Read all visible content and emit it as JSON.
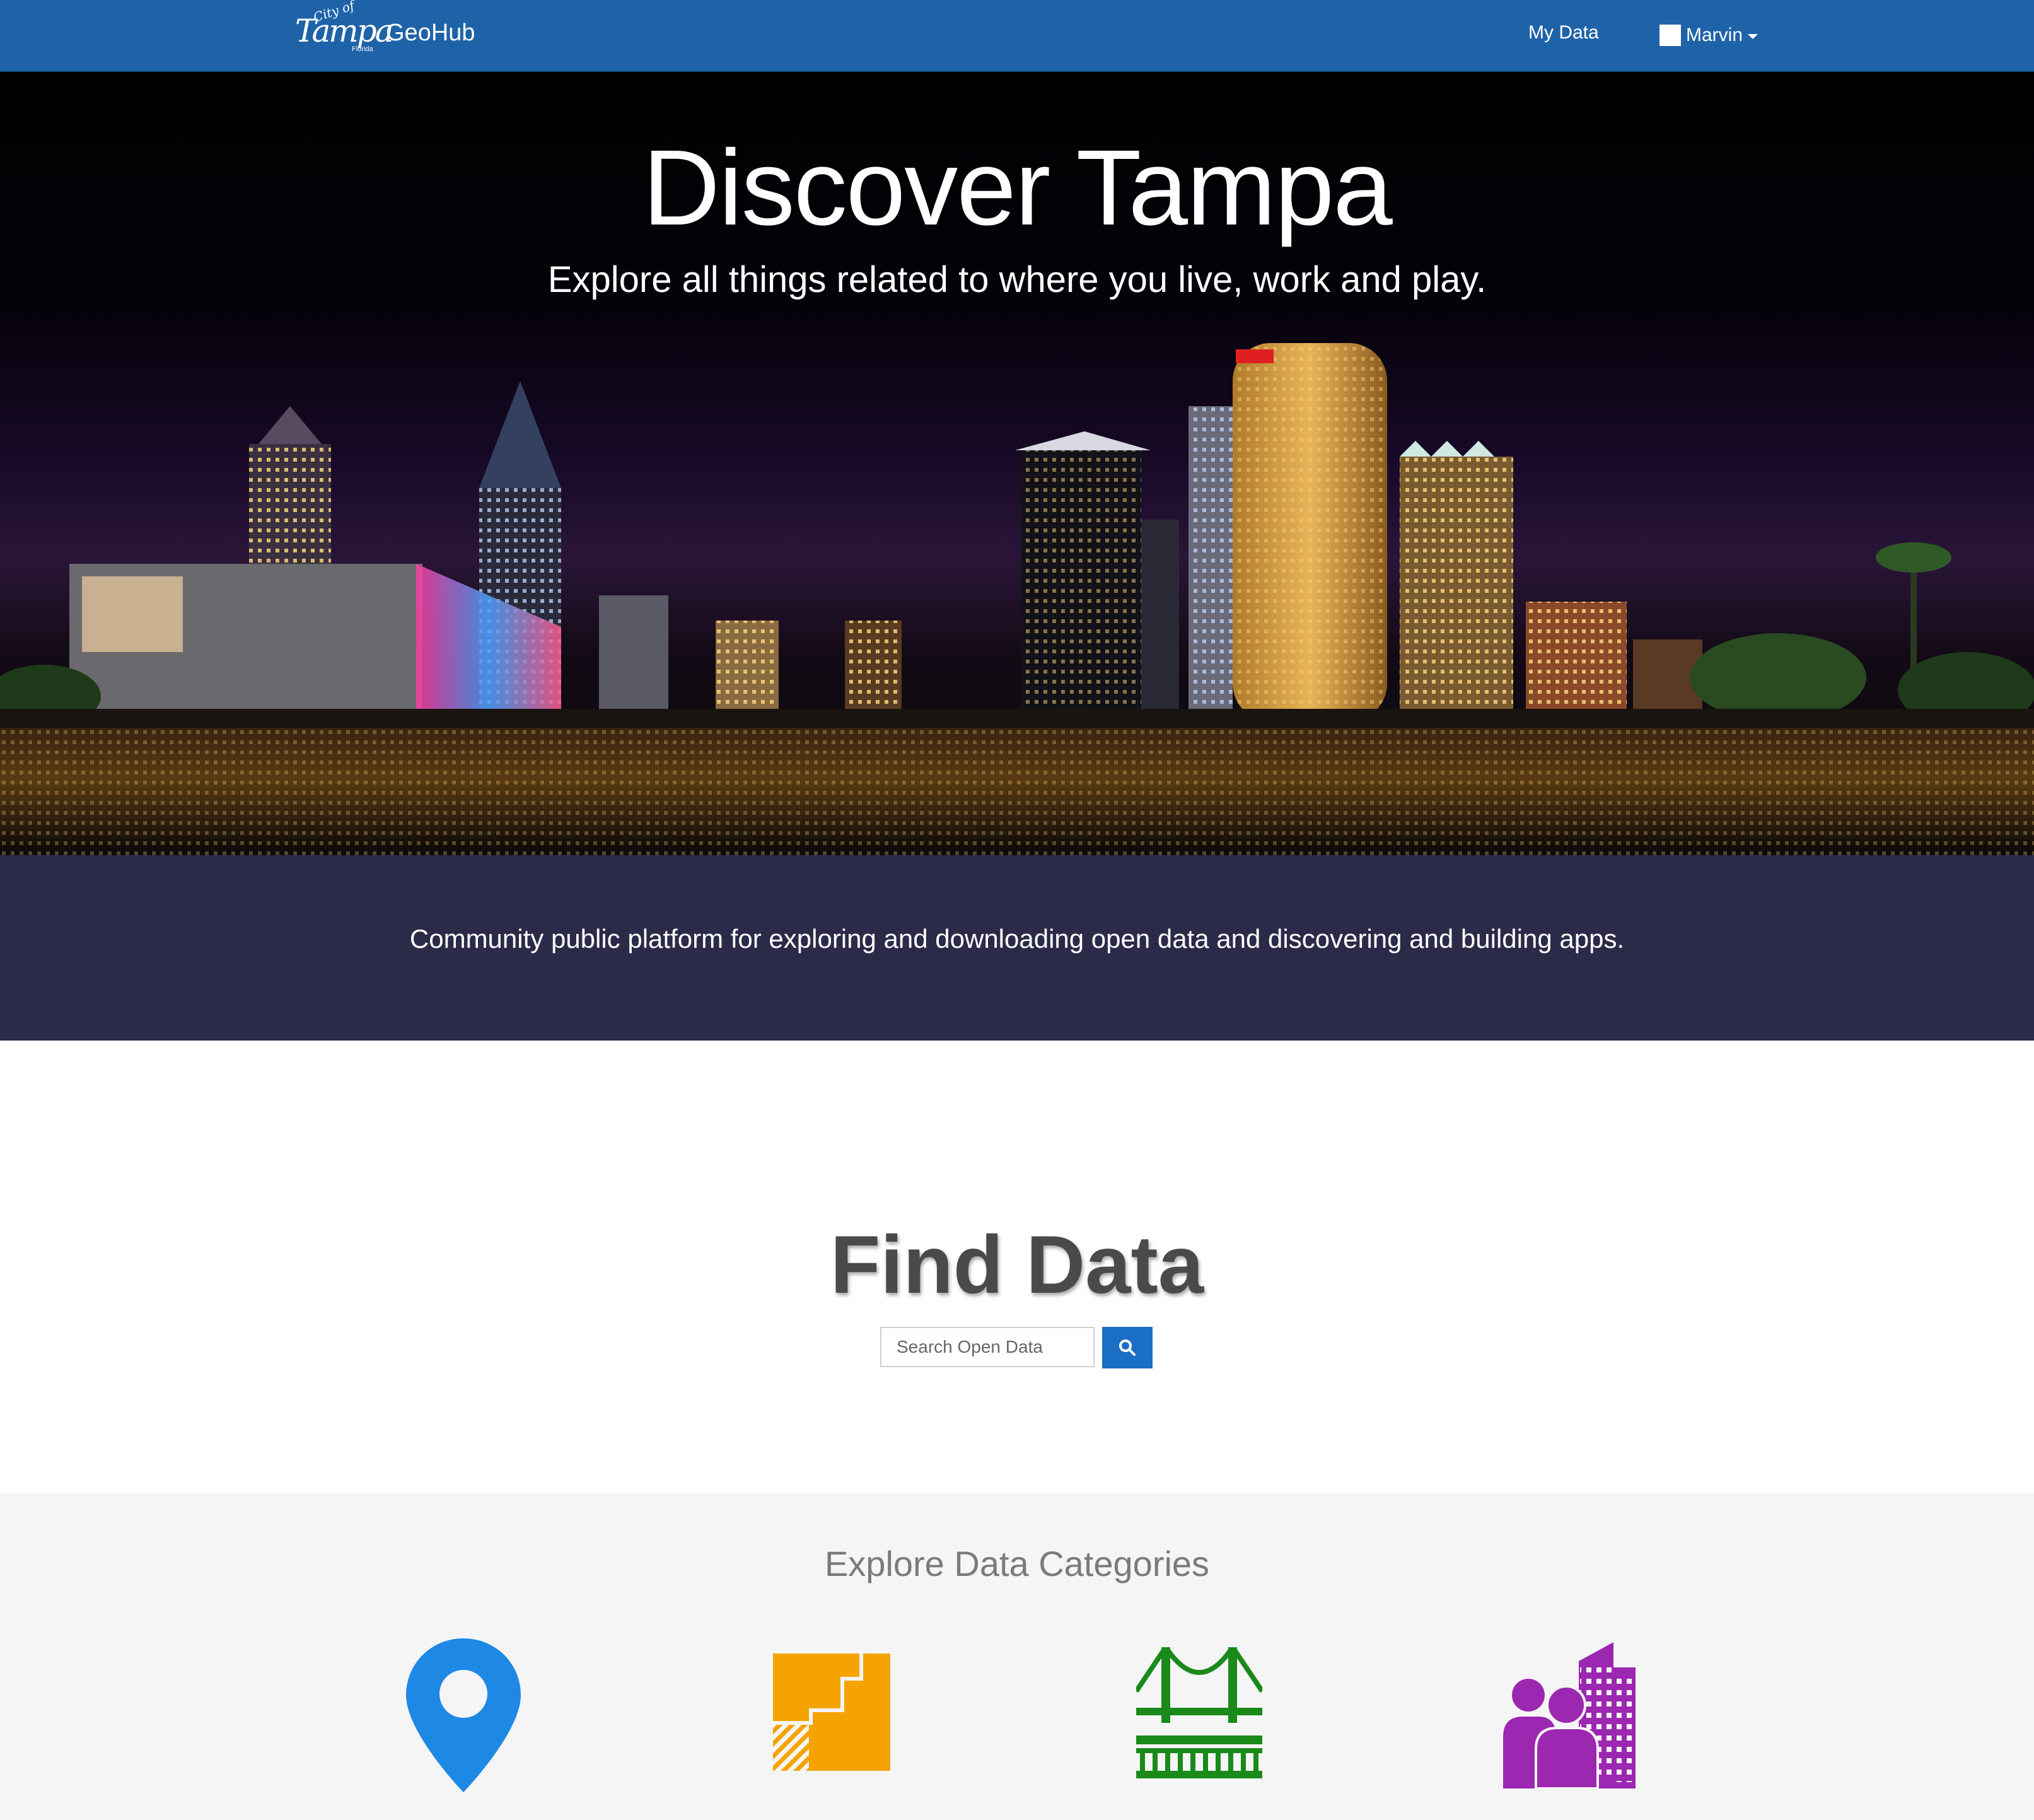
{
  "navbar": {
    "logo": {
      "city_text": "City of",
      "main_text": "Tampa",
      "sub_text": "Florida"
    },
    "brand": "GeoHub",
    "my_data_label": "My Data",
    "user_name": "Marvin",
    "background": "#1e63a8"
  },
  "hero": {
    "title": "Discover Tampa",
    "subtitle": "Explore all things related to where you live, work and play."
  },
  "tagline": {
    "text": "Community public platform for exploring and downloading open data and discovering and building apps.",
    "background": "#2b2a48"
  },
  "find_data": {
    "title": "Find Data",
    "search_placeholder": "Search Open Data",
    "search_button_icon": "search-icon",
    "button_color": "#1a6ec4"
  },
  "categories": {
    "title": "Explore Data Categories",
    "items": [
      {
        "icon": "map-pin-icon",
        "color": "#1e88e5"
      },
      {
        "icon": "parcel-icon",
        "color": "#f5a300"
      },
      {
        "icon": "bridge-icon",
        "color": "#1a8a1a"
      },
      {
        "icon": "community-icon",
        "color": "#9c27b0"
      }
    ]
  }
}
